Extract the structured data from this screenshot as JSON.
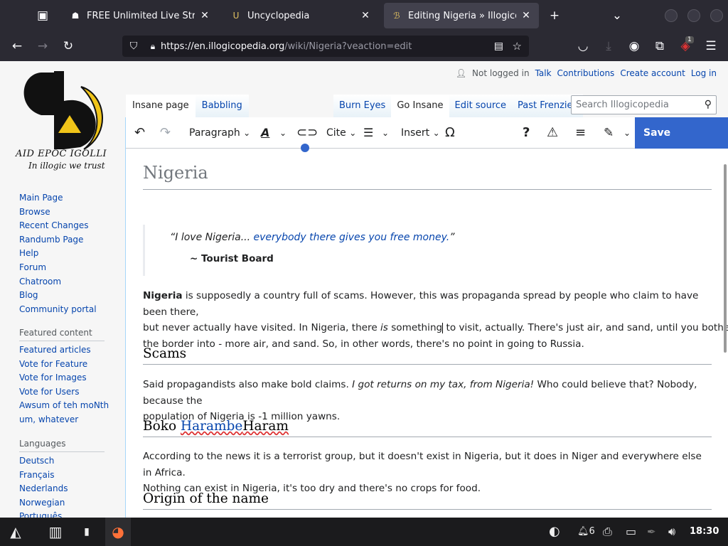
{
  "browser": {
    "tabs": [
      {
        "title": "FREE Unlimited Live Streamin"
      },
      {
        "title": "Uncyclopedia"
      },
      {
        "title": "Editing Nigeria » Illogicopedia"
      }
    ],
    "url_host": "https://en.illogicopedia.org",
    "url_rest": "/wiki/Nigeria?veaction=edit",
    "extension_badge": "1"
  },
  "user_menu": {
    "not_logged_in": "Not logged in",
    "talk": "Talk",
    "contributions": "Contributions",
    "create_account": "Create account",
    "log_in": "Log in"
  },
  "logo": {
    "line1": "AID EPOC IGOLLI",
    "line2": "In illogic we trust"
  },
  "sidebar": {
    "nav": [
      "Main Page",
      "Browse",
      "Recent Changes",
      "Randumb Page",
      "Help",
      "Forum",
      "Chatroom",
      "Blog",
      "Community portal"
    ],
    "featured_heading": "Featured content",
    "featured": [
      "Featured articles",
      "Vote for Feature",
      "Vote for Images",
      "Vote for Users",
      "Awsum of teh moNth",
      "um, whatever"
    ],
    "languages_heading": "Languages",
    "languages": [
      "Deutsch",
      "Français",
      "Nederlands",
      "Norwegian",
      "Português"
    ]
  },
  "page_tabs": {
    "left": [
      "Insane page",
      "Babbling"
    ],
    "right": [
      "Burn Eyes",
      "Go Insane",
      "Edit source",
      "Past Frenzies"
    ]
  },
  "search": {
    "placeholder": "Search Illogicopedia"
  },
  "editor_toolbar": {
    "paragraph": "Paragraph",
    "cite": "Cite",
    "insert": "Insert",
    "save": "Save changes..."
  },
  "article": {
    "title": "Nigeria",
    "quote_plain": "“I love Nigeria... ",
    "quote_link": "everybody there gives you free money.",
    "quote_end": "”",
    "quote_attribution": "~ Tourist Board",
    "intro_bold": "Nigeria",
    "intro_line1_rest": " is supposedly a country full of scams. However, this was propaganda spread by people who claim to have been there,",
    "intro_line2_a": "but never actually have visited. In Nigeria, there ",
    "intro_line2_is": "is",
    "intro_line2_b": " something",
    "intro_line2_c": " to visit, actually. There's just air, and sand, until you bother to cross",
    "intro_line3": "the border into - more air, and sand. So, in other words, there's no point in going to Russia.",
    "h_scams": "Scams",
    "scams_a": "Said propagandists also make bold claims. ",
    "scams_italic": "I got returns on my tax, from Nigeria!",
    "scams_b": " Who could believe that? Nobody, because the",
    "scams_line2": "population of Nigeria is -1 million yawns.",
    "h_boko_a": "Boko ",
    "h_boko_struck": "Harambe",
    "h_boko_b": "Haram",
    "boko_line1": "According to the news it is a terrorist group, but it doesn't exist in Nigeria, but it does in Niger and everywhere else in Africa.",
    "boko_line2": "Nothing can exist in Nigeria, it's too dry and there's no crops for food.",
    "h_origin": "Origin of the name"
  },
  "taskbar": {
    "notifications": "6",
    "clock": "18:30"
  }
}
